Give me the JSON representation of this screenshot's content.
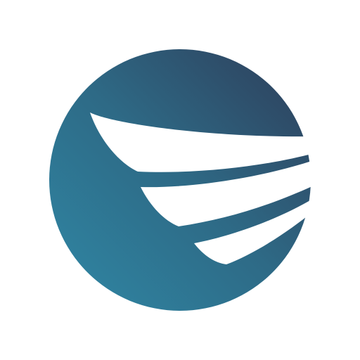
{
  "logo": {
    "icon_name": "wing-globe-logo-icon",
    "background": "#ffffff",
    "gradient_start": "#2f7f9c",
    "gradient_mid": "#2e6a86",
    "gradient_end": "#2e4a66",
    "wing_color": "#ffffff"
  }
}
